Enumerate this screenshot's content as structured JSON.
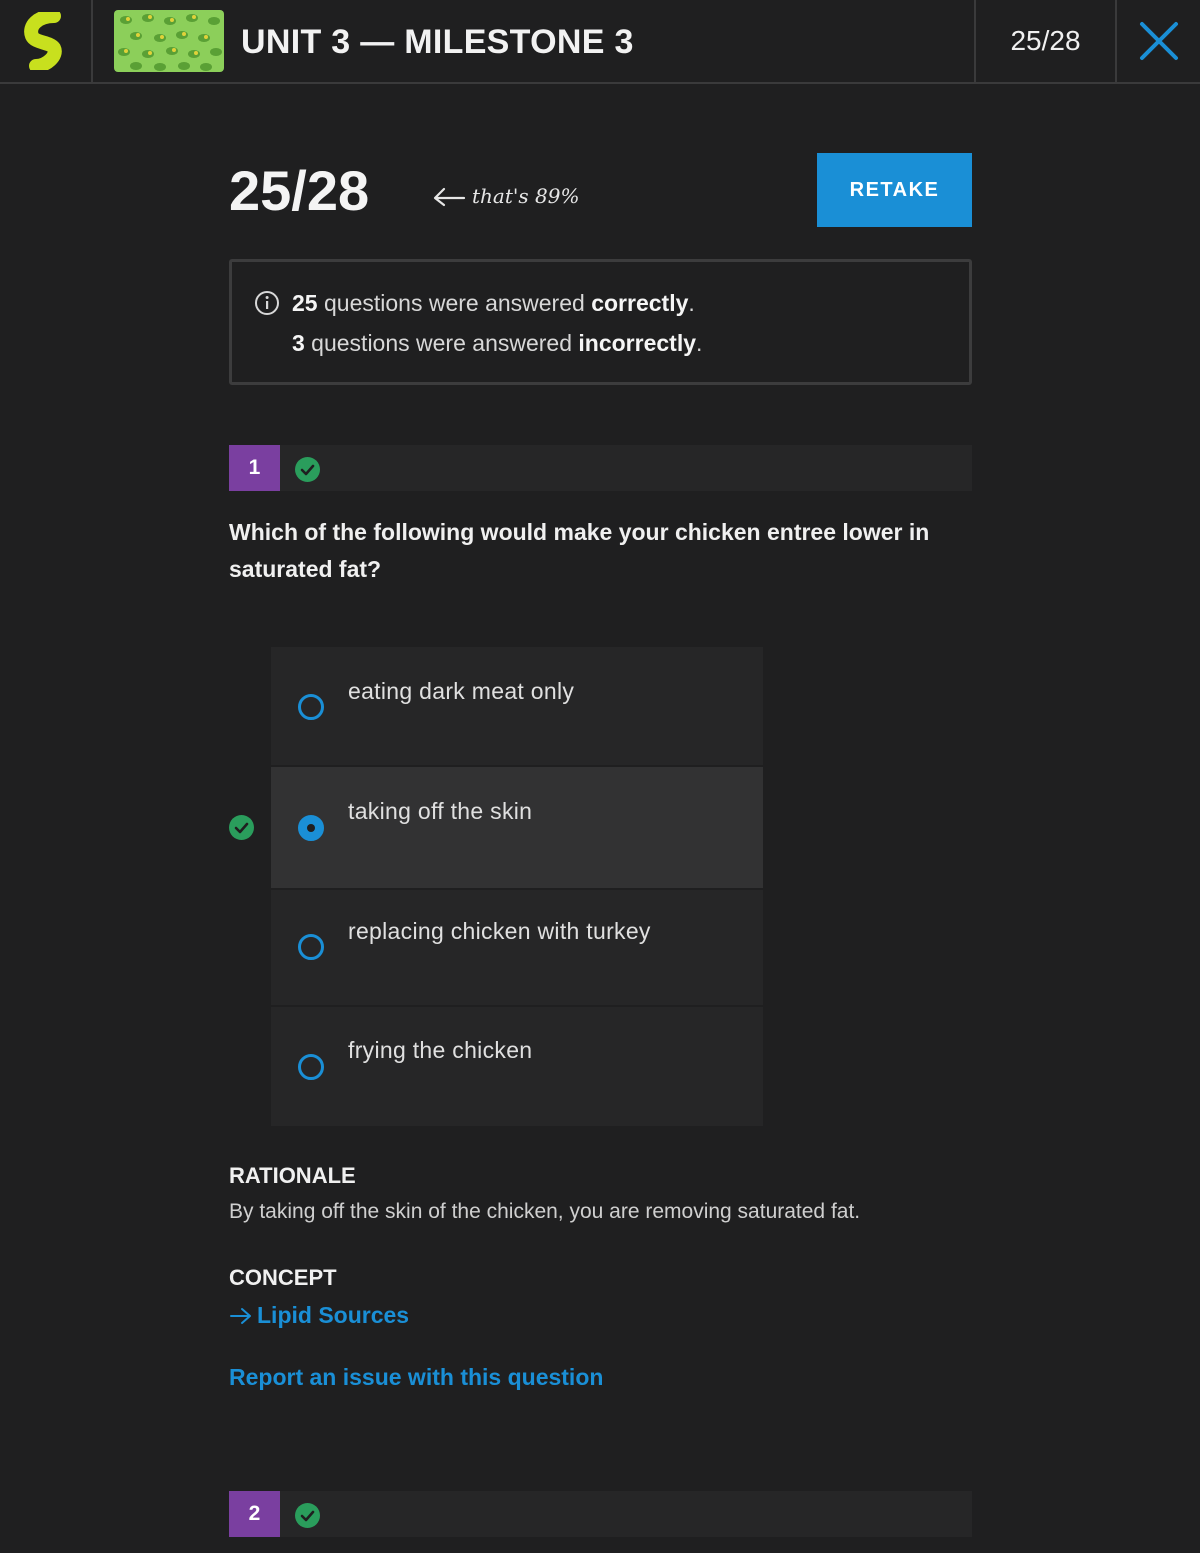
{
  "header": {
    "title": "UNIT 3 — MILESTONE 3",
    "score": "25/28"
  },
  "result": {
    "score": "25/28",
    "percent_note": "that's 89%",
    "retake_label": "RETAKE",
    "summary": {
      "correct_count": "25",
      "correct_text": " questions were answered ",
      "correct_word": "correctly",
      "incorrect_count": "3",
      "incorrect_text": " questions were answered ",
      "incorrect_word": "incorrectly",
      "period": "."
    }
  },
  "questions": [
    {
      "number": "1",
      "text": "Which of the following would make your chicken entree lower in saturated fat?",
      "options": [
        {
          "label": "eating dark meat only",
          "selected": false
        },
        {
          "label": "taking off the skin",
          "selected": true
        },
        {
          "label": "replacing chicken with turkey",
          "selected": false
        },
        {
          "label": "frying the chicken",
          "selected": false
        }
      ],
      "rationale_title": "RATIONALE",
      "rationale": "By taking off the skin of the chicken, you are removing saturated fat.",
      "concept_title": "CONCEPT",
      "concept_link": "Lipid Sources",
      "report_link": "Report an issue with this question"
    },
    {
      "number": "2"
    }
  ],
  "colors": {
    "accent": "#1a8fd6",
    "correct": "#2a9d5c",
    "badge": "#7a3fa0",
    "logo": "#c8e01e"
  }
}
